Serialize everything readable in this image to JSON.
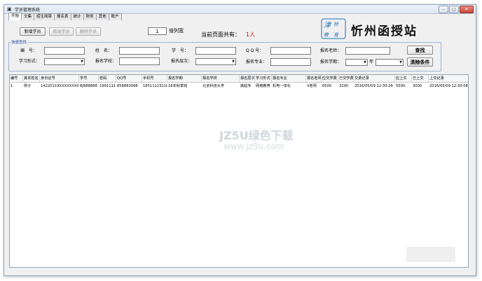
{
  "window": {
    "title": "学员管理系统"
  },
  "tabs": [
    {
      "label": "开始",
      "active": true
    },
    {
      "label": "文集"
    },
    {
      "label": "招生简章"
    },
    {
      "label": "报名表"
    },
    {
      "label": "统计"
    },
    {
      "label": "财务"
    },
    {
      "label": "其他"
    },
    {
      "label": "账户"
    }
  ],
  "toolbar": {
    "new_student": "新增学员",
    "edit_student": "修改学员",
    "delete_student": "删除学员",
    "width_value": "1",
    "width_label": "倍列宽",
    "count_label": "当前页面共有：",
    "count_value": "1人"
  },
  "logo": {
    "seal_text": "津桥教育",
    "brand": "忻州函授站"
  },
  "search": {
    "group_title": "快速查找",
    "id_label": "编　号：",
    "name_label": "姓　名：",
    "student_no_label": "学　号：",
    "qq_label": "Q Q 号：",
    "teacher_label": "报名老师：",
    "mode_label": "学习形式：",
    "school_label": "报名学校：",
    "level_label": "报名层次：",
    "major_label": "报名专业：",
    "term_label": "报名学期：",
    "year_label": "年",
    "search_button": "查找",
    "clear_button": "清除条件"
  },
  "table": {
    "headers": [
      "编号",
      "真实姓名",
      "身份证号",
      "学号",
      "密码",
      "QQ号",
      "手机号",
      "报名学期",
      "报名学校",
      "报名层次",
      "学习形式",
      "报名专业",
      "报名老师",
      "应交学费",
      "已交学费",
      "交费记录",
      "应上交",
      "已上交",
      "上交记录"
    ],
    "rows": [
      [
        "1",
        "例子",
        "14220119XXXXXXX0000",
        "BJ988888",
        "1991111",
        "858883998",
        "18511123210",
        "16年秋季班",
        "北京科技大学",
        "高起专",
        "网络教育",
        "机电一体化",
        "X老师",
        "6500",
        "3200",
        "2016/05/09 12:30:26",
        "5500",
        "3000",
        "2016/05/09 12:30:08"
      ]
    ]
  },
  "watermark": {
    "main": "JZ5U绿色下载",
    "sub": "www.jz5u.com"
  }
}
